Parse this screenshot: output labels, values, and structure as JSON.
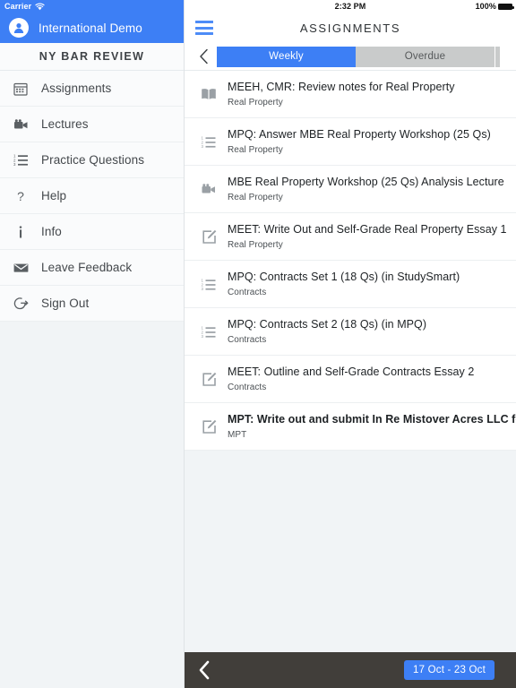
{
  "status_bar": {
    "carrier": "Carrier",
    "wifi_icon": "wifi-icon",
    "time": "2:32 PM",
    "battery_percent": "100%",
    "battery_icon": "battery-full-icon"
  },
  "sidebar": {
    "avatar_icon": "user-avatar-icon",
    "user_name": "International Demo",
    "course_title": "NY BAR REVIEW",
    "items": [
      {
        "label": "Assignments",
        "icon": "calendar-icon"
      },
      {
        "label": "Lectures",
        "icon": "video-camera-icon"
      },
      {
        "label": "Practice Questions",
        "icon": "numbered-list-icon"
      },
      {
        "label": "Help",
        "icon": "question-mark-icon"
      },
      {
        "label": "Info",
        "icon": "info-icon"
      },
      {
        "label": "Leave Feedback",
        "icon": "envelope-icon"
      },
      {
        "label": "Sign Out",
        "icon": "sign-out-icon"
      }
    ]
  },
  "nav": {
    "menu_icon": "hamburger-menu-icon",
    "title": "ASSIGNMENTS",
    "back_icon": "chevron-left-icon"
  },
  "tabs": [
    {
      "label": "Weekly",
      "active": true
    },
    {
      "label": "Overdue",
      "active": false
    }
  ],
  "assignments": [
    {
      "title": "MEEH, CMR: Review notes for Real Property",
      "subject": "Real Property",
      "icon": "book-icon",
      "bold": false
    },
    {
      "title": "MPQ: Answer MBE Real Property Workshop (25 Qs)",
      "subject": "Real Property",
      "icon": "numbered-list-icon",
      "bold": false
    },
    {
      "title": "MBE Real Property Workshop (25 Qs) Analysis Lecture",
      "subject": "Real Property",
      "icon": "video-camera-icon",
      "bold": false
    },
    {
      "title": "MEET: Write Out and Self-Grade Real Property Essay 1",
      "subject": "Real Property",
      "icon": "pencil-square-icon",
      "bold": false
    },
    {
      "title": "MPQ: Contracts Set 1 (18 Qs) (in StudySmart)",
      "subject": "Contracts",
      "icon": "numbered-list-icon",
      "bold": false
    },
    {
      "title": "MPQ: Contracts Set 2 (18 Qs) (in MPQ)",
      "subject": "Contracts",
      "icon": "numbered-list-icon",
      "bold": false
    },
    {
      "title": "MEET: Outline and Self-Grade Contracts Essay 2",
      "subject": "Contracts",
      "icon": "pencil-square-icon",
      "bold": false
    },
    {
      "title": "MPT: Write out and submit In Re Mistover Acres LLC for grading",
      "subject": "MPT",
      "icon": "pencil-square-icon",
      "bold": true
    }
  ],
  "bottom_bar": {
    "back_icon": "chevron-left-icon",
    "date_range": "17 Oct - 23 Oct"
  },
  "colors": {
    "accent_blue": "#3d7ff5",
    "tab_inactive": "#c9cbcb",
    "bottom_bar": "#413e3a",
    "panel_fill": "#f1f4f6"
  }
}
